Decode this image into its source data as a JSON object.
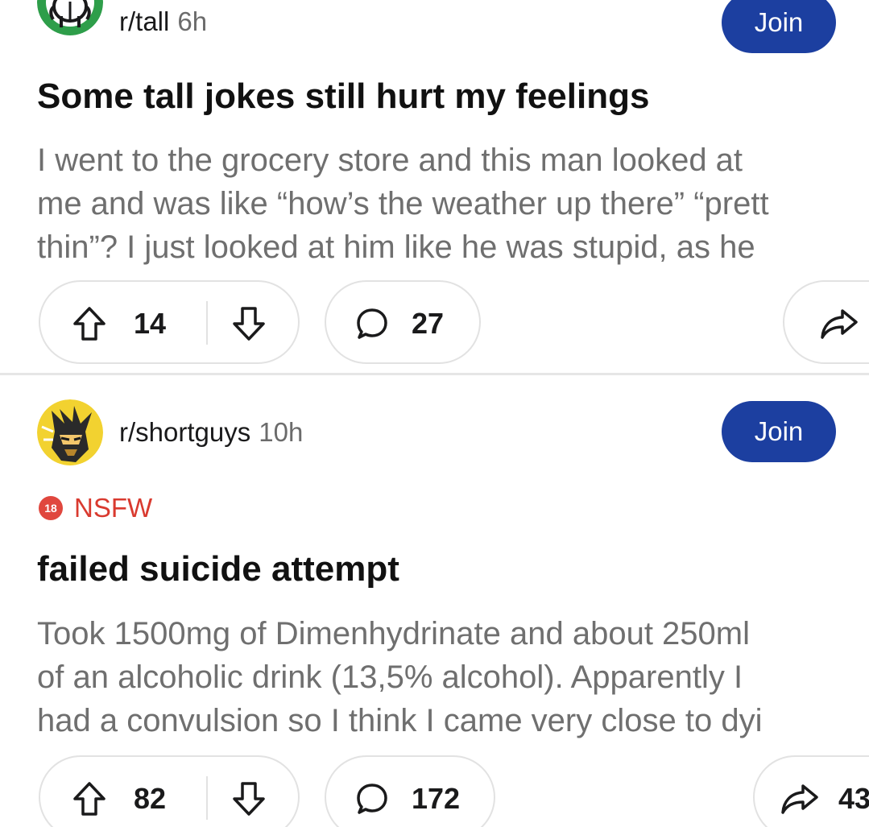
{
  "feed": {
    "posts": [
      {
        "subreddit": "r/tall",
        "age": "6h",
        "join_label": "Join",
        "nsfw": false,
        "title": "Some tall jokes still hurt my feelings",
        "body_lines": [
          "I went to the grocery store and this man looked at",
          "me and was like “how’s the weather up there” “prett",
          "thin”? I just looked at him like he was stupid, as he"
        ],
        "upvotes": "14",
        "comments": "27",
        "shares": "",
        "avatar_icon": "reddit-snoo-avatar-icon"
      },
      {
        "subreddit": "r/shortguys",
        "age": "10h",
        "join_label": "Join",
        "nsfw": true,
        "nsfw_badge": "18",
        "nsfw_label": "NSFW",
        "title": "failed suicide attempt",
        "body_lines": [
          "Took 1500mg of Dimenhydrinate and about 250ml",
          "of an alcoholic drink (13,5% alcohol). Apparently I",
          "had a convulsion so I think I came very close to dyi"
        ],
        "upvotes": "82",
        "comments": "172",
        "shares": "43",
        "avatar_icon": "comic-character-avatar-icon"
      }
    ]
  },
  "colors": {
    "join_button": "#1c3fa0",
    "nsfw_red": "#d93a2f",
    "body_text": "#6f6f6f",
    "title_text": "#111111",
    "tall_avatar_green": "#2e9e4a",
    "shortguys_avatar_yellow": "#f2d230"
  }
}
